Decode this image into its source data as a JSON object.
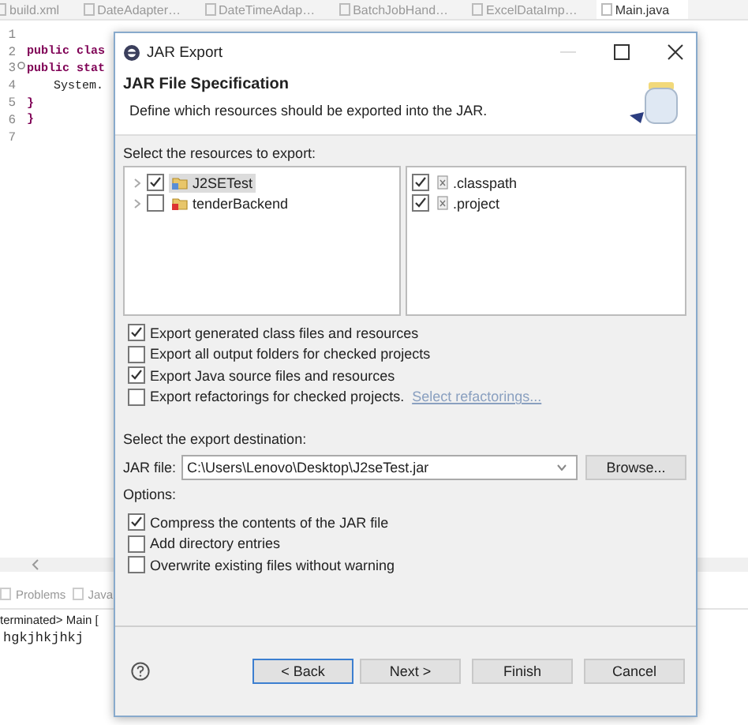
{
  "editor": {
    "tabs": [
      {
        "label": "build.xml",
        "selected": false
      },
      {
        "label": "DateAdapter…",
        "selected": false
      },
      {
        "label": "DateTimeAdap…",
        "selected": false
      },
      {
        "label": "BatchJobHand…",
        "selected": false
      },
      {
        "label": "ExcelDataImp…",
        "selected": false
      },
      {
        "label": "Main.java",
        "selected": true
      }
    ],
    "lines": [
      {
        "number": "1"
      },
      {
        "number": "2",
        "code": "public clas"
      },
      {
        "number": "3",
        "code": "public stat",
        "folded": false
      },
      {
        "number": "4",
        "code": "System.",
        "indent": true
      },
      {
        "number": "5",
        "code": "}"
      },
      {
        "number": "6",
        "code": "}"
      },
      {
        "number": "7"
      }
    ]
  },
  "console": {
    "tabs": [
      {
        "label": "Problems"
      },
      {
        "label": "Java"
      }
    ],
    "header": "terminated> Main [",
    "output": "hgkjhkjhkj"
  },
  "dialog": {
    "title": "JAR Export",
    "heading": "JAR File Specification",
    "description": "Define which resources should be exported into the JAR.",
    "resources_label": "Select the resources to export:",
    "projects": [
      {
        "label": "J2SETest",
        "checked": true,
        "selected": true
      },
      {
        "label": "tenderBackend",
        "checked": false,
        "selected": false
      }
    ],
    "files": [
      {
        "label": ".classpath",
        "checked": true
      },
      {
        "label": ".project",
        "checked": true
      }
    ],
    "export_options": [
      {
        "label": "Export generated class files and resources",
        "checked": true
      },
      {
        "label": "Export all output folders for checked projects",
        "checked": false
      },
      {
        "label": "Export Java source files and resources",
        "checked": true
      },
      {
        "label": "Export refactorings for checked projects.",
        "checked": false,
        "link": "Select refactorings..."
      }
    ],
    "destination_label": "Select the export destination:",
    "jar_file_label": "JAR file:",
    "jar_file_value": "C:\\Users\\Lenovo\\Desktop\\J2seTest.jar",
    "browse": "Browse...",
    "options_label": "Options:",
    "options": [
      {
        "label": "Compress the contents of the JAR file",
        "checked": true
      },
      {
        "label": "Add directory entries",
        "checked": false
      },
      {
        "label": "Overwrite existing files without warning",
        "checked": false
      }
    ],
    "buttons": [
      {
        "label": "< Back",
        "focused": true
      },
      {
        "label": "Next >",
        "focused": false
      },
      {
        "label": "Finish",
        "focused": false
      },
      {
        "label": "Cancel",
        "focused": false
      }
    ]
  }
}
